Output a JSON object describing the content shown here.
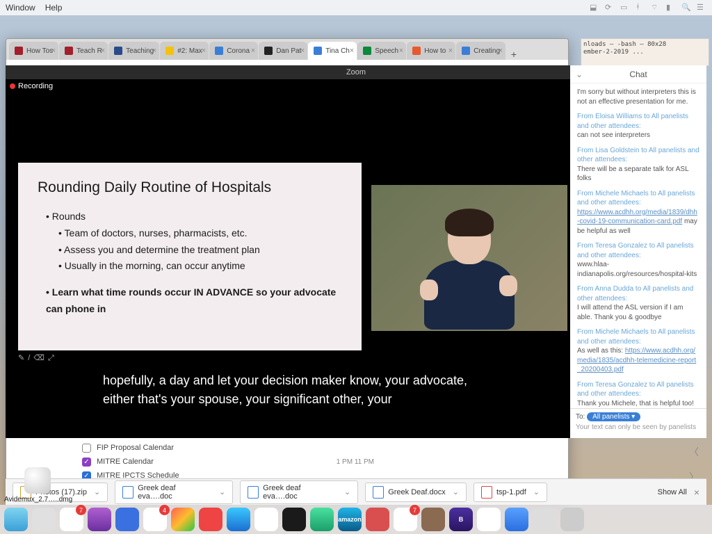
{
  "menubar": {
    "items": [
      "Window",
      "Help"
    ]
  },
  "terminal": {
    "line1": "nloads — -bash — 80x28",
    "line2": "ember-2-2019 ..."
  },
  "tabs": [
    {
      "label": "How Tos",
      "fav": "#a21f2d"
    },
    {
      "label": "Teach R",
      "fav": "#a21f2d"
    },
    {
      "label": "Teaching",
      "fav": "#2a4b8a"
    },
    {
      "label": "#2: Max",
      "fav": "#f4c20d"
    },
    {
      "label": "Corona",
      "fav": "#3a7fd6"
    },
    {
      "label": "Dan Pat",
      "fav": "#222"
    },
    {
      "label": "Tina Ch",
      "fav": "#3a7fd6",
      "active": true
    },
    {
      "label": "Speech",
      "fav": "#0a8a3a"
    },
    {
      "label": "How to",
      "fav": "#e65a2d"
    },
    {
      "label": "Creating",
      "fav": "#3a7fd6"
    }
  ],
  "zoom": {
    "title": "Zoom",
    "recording": "Recording",
    "slide": {
      "title": "Rounding Daily Routine of Hospitals",
      "top": "Rounds",
      "b1": "Team of doctors, nurses, pharmacists, etc.",
      "b2": "Assess you and determine the treatment plan",
      "b3": "Usually in the morning, can occur anytime",
      "learn": "Learn what time rounds occur IN ADVANCE so your advocate can phone in"
    },
    "tools": "✎ / ⌫ ⤢",
    "captions": "hopefully, a day and let your decision maker  know, your advocate, either that's your spouse,  your significant other, your"
  },
  "chat": {
    "title": "Chat",
    "messages": [
      {
        "body": "I'm sorry but without interpreters this is not an effective presentation for me."
      },
      {
        "from": "From Eloisa Williams to ",
        "aud": "All panelists and other attendees:",
        "body": "can not see interpreters"
      },
      {
        "from": "From Lisa Goldstein to ",
        "aud": "All panelists and other attendees:",
        "body": "There will be a separate talk for ASL folks"
      },
      {
        "from": "From Michele Michaels to ",
        "aud": "All panelists and other attendees:",
        "body_pre": "",
        "link": "https://www.acdhh.org/media/1839/dhh-covid-19-communication-card.pdf",
        "body_post": " may be helpful as well"
      },
      {
        "from": "From Teresa Gonzalez to ",
        "aud": "All panelists and other attendees:",
        "body": "www.hlaa-indianapolis.org/resources/hospital-kits"
      },
      {
        "from": "From Anna Dudda to ",
        "aud": "All panelists and other attendees:",
        "body": "I will attend the ASL version if I am able. Thank you & goodbye"
      },
      {
        "from": "From Michele Michaels to ",
        "aud": "All panelists and other attendees:",
        "body_pre": "As well as this:  ",
        "link": "https://www.acdhh.org/media/1835/acdhh-telemedicine-report_20200403.pdf"
      },
      {
        "from": "From Teresa Gonzalez to ",
        "aud": "All panelists and other attendees:",
        "body": "Thank you Michele, that is helpful too!"
      }
    ],
    "to_label": "To:",
    "to_pill": "All panelists ▾",
    "hint": "Your text can only be seen by panelists"
  },
  "calendar": {
    "r1": "FIP Proposal Calendar",
    "r2": "MITRE Calendar",
    "r2t": "1 PM   11 PM",
    "r3": "MITRE IPCTS Schedule"
  },
  "downloads": [
    {
      "name": "Photos (17).zip",
      "type": "zip"
    },
    {
      "name": "Greek deaf eva….doc",
      "type": "doc"
    },
    {
      "name": "Greek deaf eva….doc",
      "type": "doc"
    },
    {
      "name": "Greek Deaf.docx",
      "type": "doc"
    },
    {
      "name": "tsp-1.pdf",
      "type": "pdf"
    }
  ],
  "shelf": {
    "showall": "Show All"
  },
  "dmg": {
    "label": "Avidemux_2.7…..dmg"
  },
  "dock": [
    {
      "c": "linear-gradient(180deg,#7fd4f0,#3aa0d8)"
    },
    {
      "c": "#e0e0e0"
    },
    {
      "c": "#fff",
      "badge": "7"
    },
    {
      "c": "linear-gradient(#b060d0,#6a2fa0)"
    },
    {
      "c": "#3a70e0"
    },
    {
      "c": "#fff",
      "badge": "4"
    },
    {
      "c": "linear-gradient(135deg,#ff5f57,#febc2e,#28c840)"
    },
    {
      "c": "#e44"
    },
    {
      "c": "linear-gradient(#3ac7ff,#1a6fd0)"
    },
    {
      "c": "#fff"
    },
    {
      "c": "#1a1a1a"
    },
    {
      "c": "linear-gradient(#4ae0a0,#1a9f6a)"
    },
    {
      "c": "linear-gradient(#20b4e8,#0a5a88)",
      "txt": "amazon"
    },
    {
      "c": "#d94f4f"
    },
    {
      "c": "#fff",
      "badge": "7"
    },
    {
      "c": "#8a6a50"
    },
    {
      "c": "linear-gradient(#4a2fa0,#2a1560)",
      "txt": "B"
    },
    {
      "c": "#fff"
    },
    {
      "c": "linear-gradient(#5aa0ff,#2a6fe0)"
    },
    {
      "c": "#ddd"
    },
    {
      "c": "#ccc"
    }
  ]
}
